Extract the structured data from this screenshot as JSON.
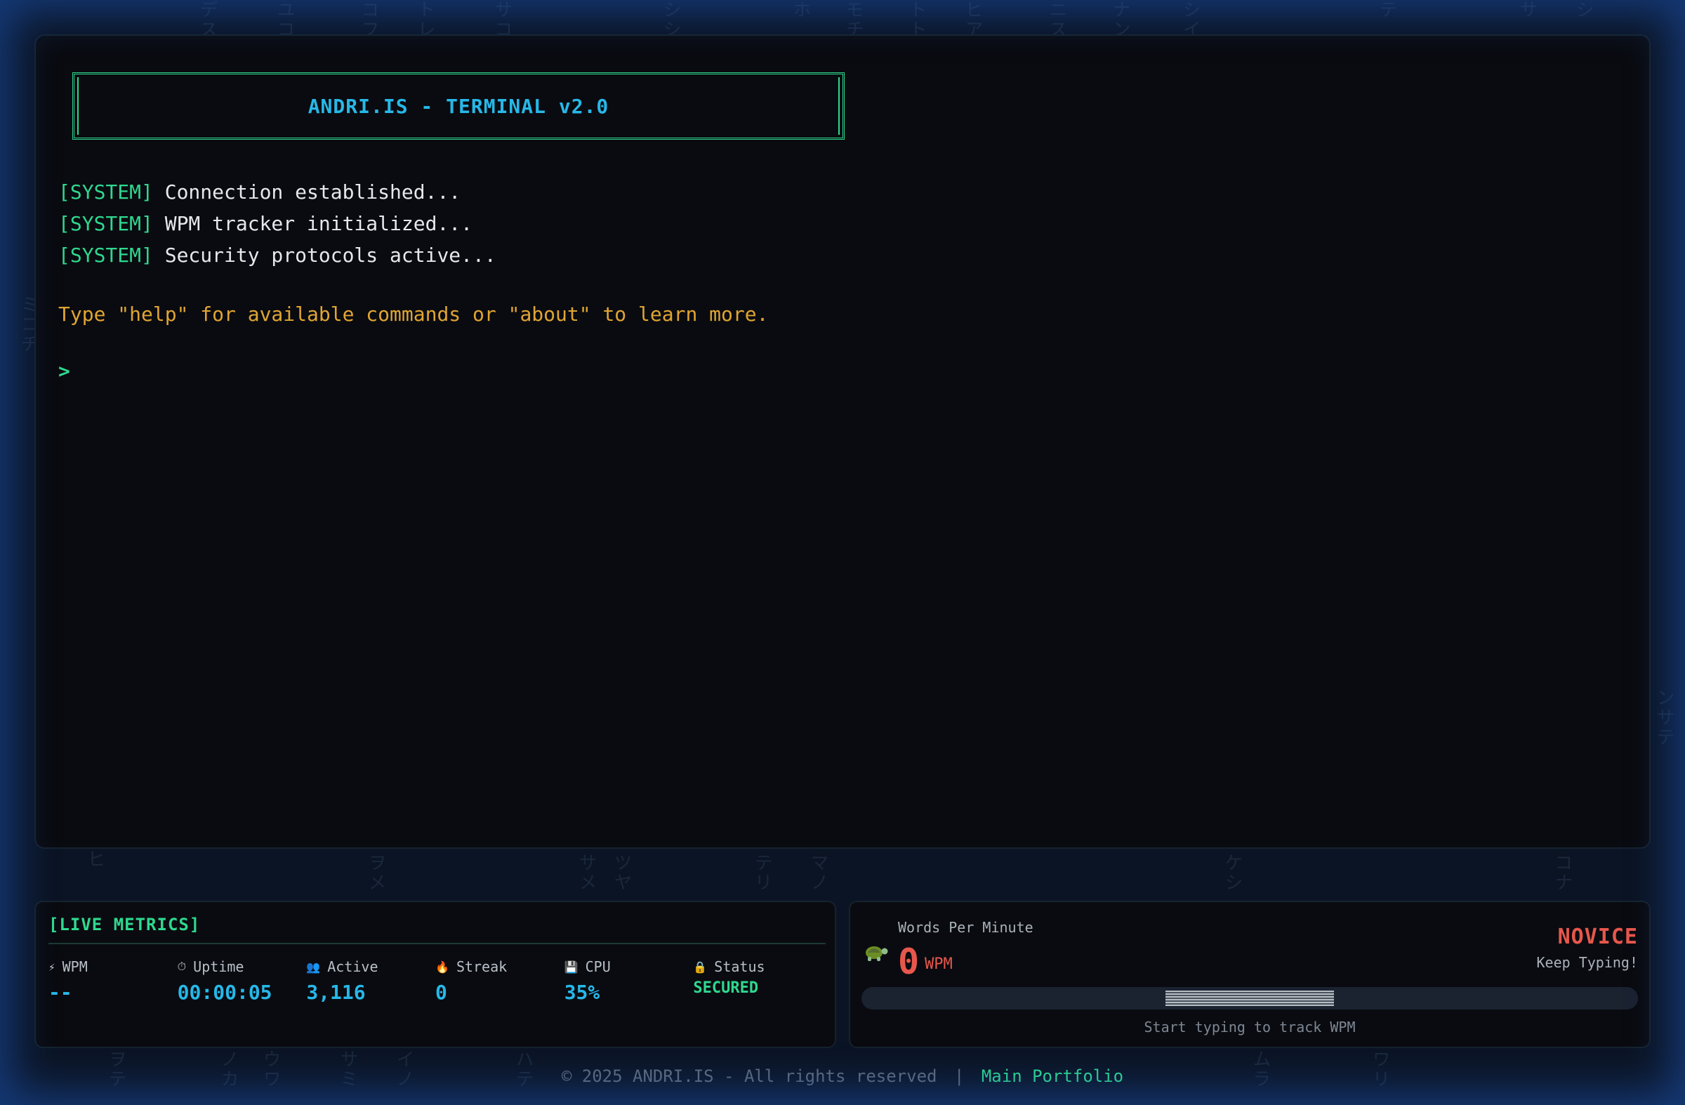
{
  "terminal": {
    "banner_title": "ANDRI.IS - TERMINAL v2.0",
    "log": [
      {
        "tag": "[SYSTEM]",
        "text": " Connection established..."
      },
      {
        "tag": "[SYSTEM]",
        "text": " WPM tracker initialized..."
      },
      {
        "tag": "[SYSTEM]",
        "text": " Security protocols active..."
      }
    ],
    "hint": "Type \"help\" for available commands or \"about\" to learn more.",
    "prompt_symbol": ">",
    "input_value": ""
  },
  "metrics": {
    "title": "[LIVE METRICS]",
    "items": [
      {
        "icon": "lightning-icon",
        "label": "WPM",
        "value": "--"
      },
      {
        "icon": "clock-icon",
        "label": "Uptime",
        "value": "00:00:05"
      },
      {
        "icon": "users-icon",
        "label": "Active",
        "value": "3,116"
      },
      {
        "icon": "flame-icon",
        "label": "Streak",
        "value": "0"
      },
      {
        "icon": "floppy-disk-icon",
        "label": "CPU",
        "value": "35%"
      },
      {
        "icon": "lock-icon",
        "label": "Status",
        "value": "SECURED"
      }
    ]
  },
  "wpm": {
    "label": "Words Per Minute",
    "icon": "turtle-icon",
    "value": "0",
    "unit": "WPM",
    "rank": "NOVICE",
    "rank_sub": "Keep Typing!",
    "caption": "Start typing to track WPM"
  },
  "footer": {
    "copyright": "© 2025 ANDRI.IS - All rights reserved",
    "separator": "|",
    "link_label": "Main Portfolio"
  },
  "colors": {
    "accent_green": "#2fd88f",
    "accent_cyan": "#27b8e8",
    "warning_amber": "#e0a532",
    "danger_red": "#e8574c",
    "terminal_bg": "#0a0b10"
  }
}
